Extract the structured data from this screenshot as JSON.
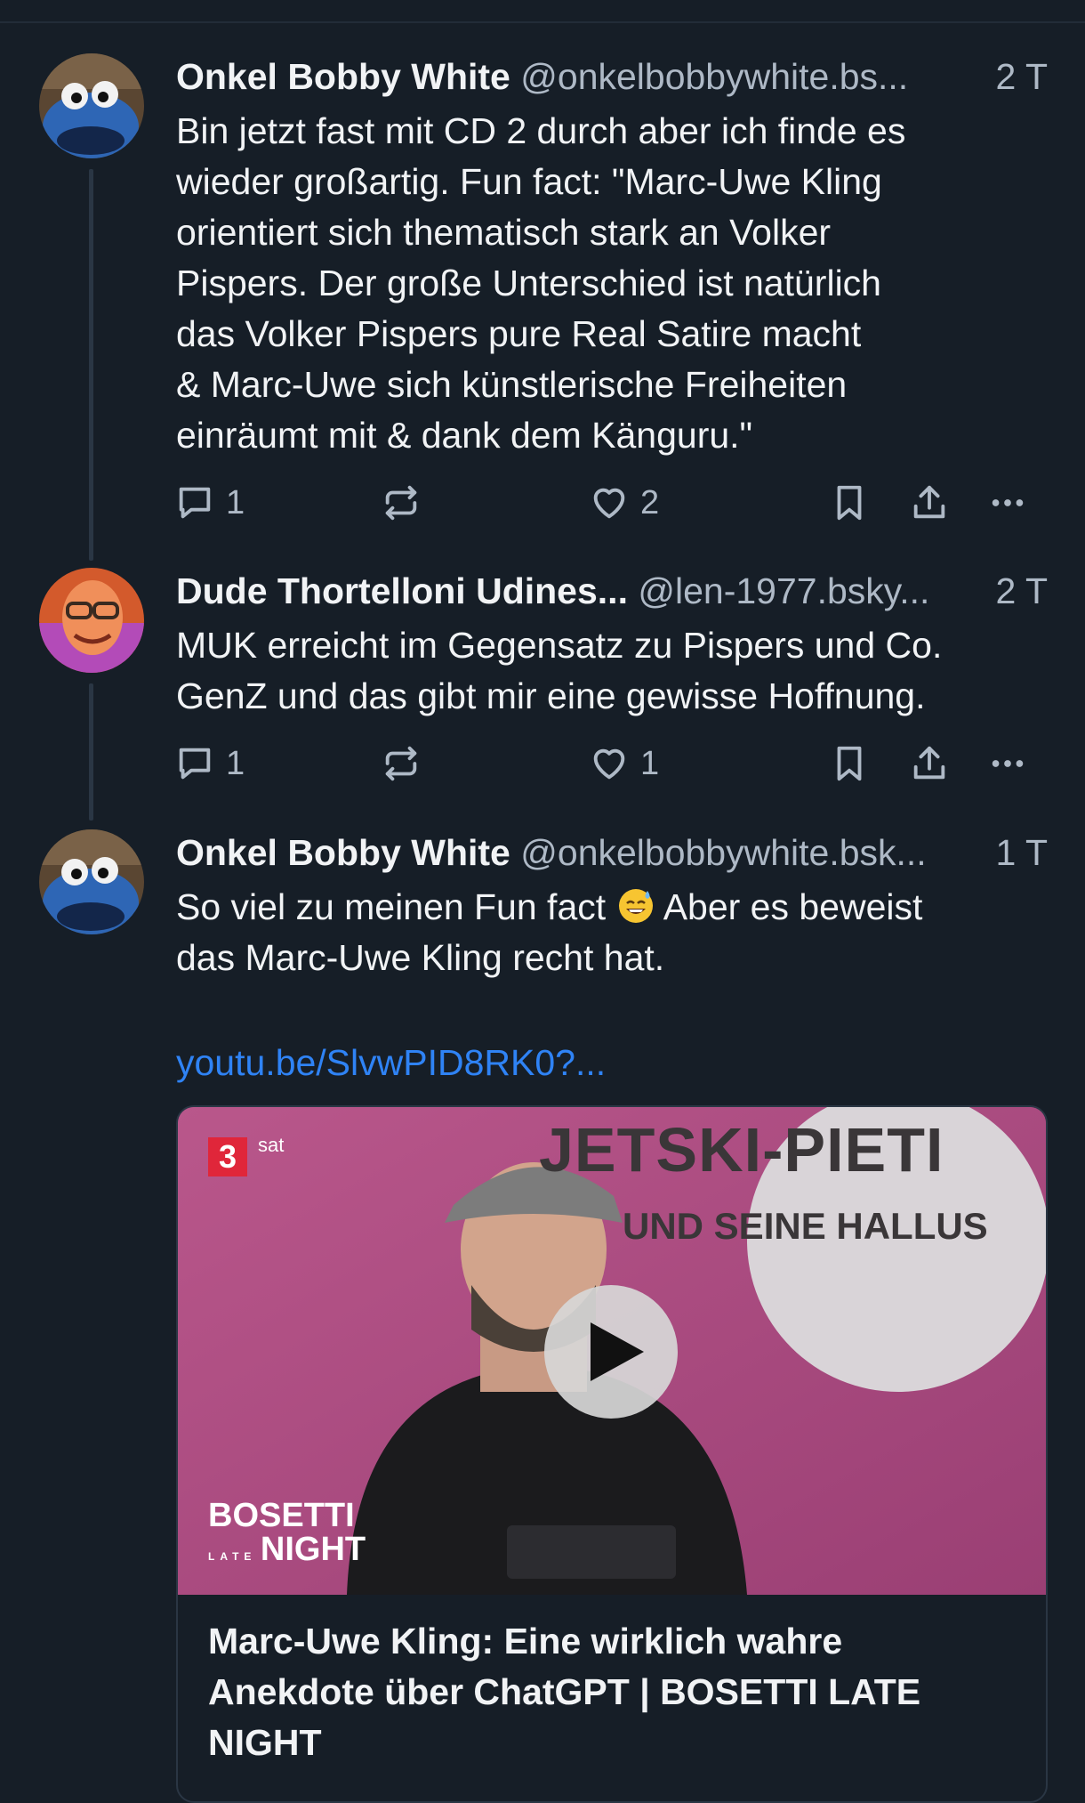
{
  "posts": [
    {
      "name": "Onkel Bobby White",
      "handle": "@onkelbobbywhite.bs...",
      "time": "2 T",
      "text_lines": [
        "Bin jetzt fast mit CD 2 durch aber ich finde es",
        "wieder großartig. Fun fact: \"Marc-Uwe Kling",
        "orientiert sich thematisch stark an Volker",
        "Pispers. Der große Unterschied ist natürlich",
        "das Volker Pispers pure Real Satire macht",
        "& Marc-Uwe sich künstlerische Freiheiten",
        "einräumt mit & dank dem Känguru.\""
      ],
      "reply_count": "1",
      "like_count": "2"
    },
    {
      "name": "Dude Thortelloni Udines...",
      "handle": "@len-1977.bsky...",
      "time": "2 T",
      "text_lines": [
        "MUK erreicht im Gegensatz zu Pispers und Co.",
        "GenZ und das gibt mir eine gewisse Hoffnung."
      ],
      "reply_count": "1",
      "like_count": "1"
    },
    {
      "name": "Onkel Bobby White",
      "handle": "@onkelbobbywhite.bsk...",
      "time": "1 T",
      "line1_before_emoji": "So viel zu meinen Fun fact",
      "line1_after_emoji": "Aber es beweist",
      "line2": "das Marc-Uwe Kling recht hat.",
      "emoji": "grinning-sweat-emoji",
      "link": "youtu.be/SlvwPID8RK0?...",
      "embed": {
        "channel_logo": "3",
        "channel_sat": "sat",
        "headline1": "JETSKI-PIETI",
        "headline2": "UND SEINE HALLUS",
        "show_logo_line1": "BOSETTI",
        "show_logo_late": "LATE",
        "show_logo_line2": "NIGHT",
        "title_lines": [
          "Marc-Uwe Kling: Eine wirklich wahre",
          "Anekdote über ChatGPT | BOSETTI LATE",
          "NIGHT"
        ]
      }
    }
  ],
  "icons": {
    "reply": "speech-bubble-icon",
    "repost": "repost-arrows-icon",
    "like": "heart-icon",
    "bookmark": "bookmark-icon",
    "share": "share-upload-icon",
    "more": "more-dots-icon",
    "play": "play-icon"
  },
  "colors": {
    "background": "#161e27",
    "text": "#f1f3f5",
    "muted": "#aeb9c6",
    "link": "#2f83f5",
    "thumbnail": "#a84b80"
  }
}
